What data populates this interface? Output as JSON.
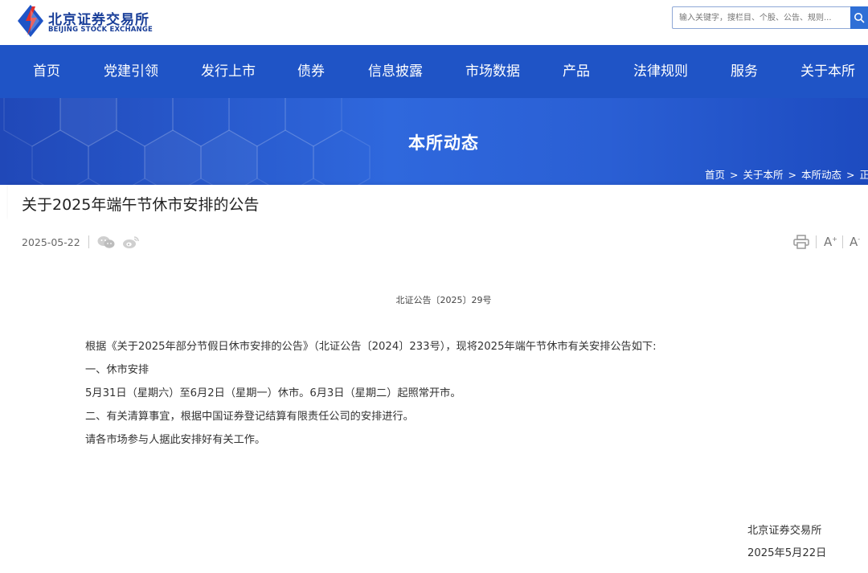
{
  "brand": {
    "name_cn": "北京证券交易所",
    "name_en": "BEIJING STOCK EXCHANGE"
  },
  "search": {
    "placeholder": "输入关键字，搜栏目、个股、公告、规则..."
  },
  "nav": {
    "items": [
      {
        "label": "首页"
      },
      {
        "label": "党建引领"
      },
      {
        "label": "发行上市"
      },
      {
        "label": "债券"
      },
      {
        "label": "信息披露"
      },
      {
        "label": "市场数据"
      },
      {
        "label": "产品"
      },
      {
        "label": "法律规则"
      },
      {
        "label": "服务"
      },
      {
        "label": "关于本所"
      }
    ]
  },
  "banner": {
    "title": "本所动态"
  },
  "breadcrumb": {
    "items": [
      "首页",
      "关于本所",
      "本所动态",
      "正"
    ],
    "separator": ">"
  },
  "article": {
    "title": "关于2025年端午节休市安排的公告",
    "date": "2025-05-22",
    "doc_number": "北证公告〔2025〕29号",
    "paragraphs": [
      "根据《关于2025年部分节假日休市安排的公告》（北证公告〔2024〕233号），现将2025年端午节休市有关安排公告如下:",
      "一、休市安排",
      "5月31日（星期六）至6月2日（星期一）休市。6月3日（星期二）起照常开市。",
      "二、有关清算事宜，根据中国证券登记结算有限责任公司的安排进行。",
      "请各市场参与人据此安排好有关工作。"
    ],
    "signature": "北京证券交易所",
    "sign_date": "2025年5月22日"
  },
  "toolbar": {
    "font_large": "A",
    "font_large_sup": "+",
    "font_small": "A",
    "font_small_sup": "-"
  },
  "colors": {
    "brand_blue": "#1f54c6",
    "brand_red": "#e0302d",
    "text": "#333333"
  }
}
